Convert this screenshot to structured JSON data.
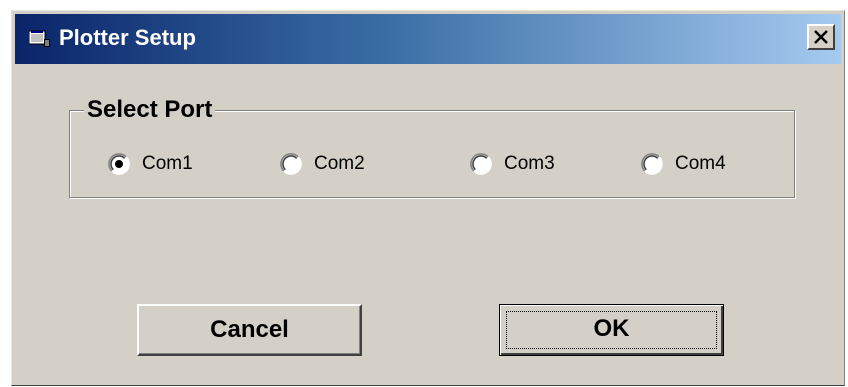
{
  "window": {
    "title": "Plotter Setup",
    "close_label": "✕"
  },
  "port_group": {
    "legend": "Select Port",
    "selected": "Com1",
    "options": [
      {
        "label": "Com1",
        "checked": true
      },
      {
        "label": "Com2",
        "checked": false
      },
      {
        "label": "Com3",
        "checked": false
      },
      {
        "label": "Com4",
        "checked": false
      }
    ]
  },
  "buttons": {
    "cancel_label": "Cancel",
    "ok_label": "OK"
  },
  "colors": {
    "title_gradient_start": "#0a246a",
    "title_gradient_end": "#a6caf0",
    "dialog_face": "#d4d0c8"
  }
}
